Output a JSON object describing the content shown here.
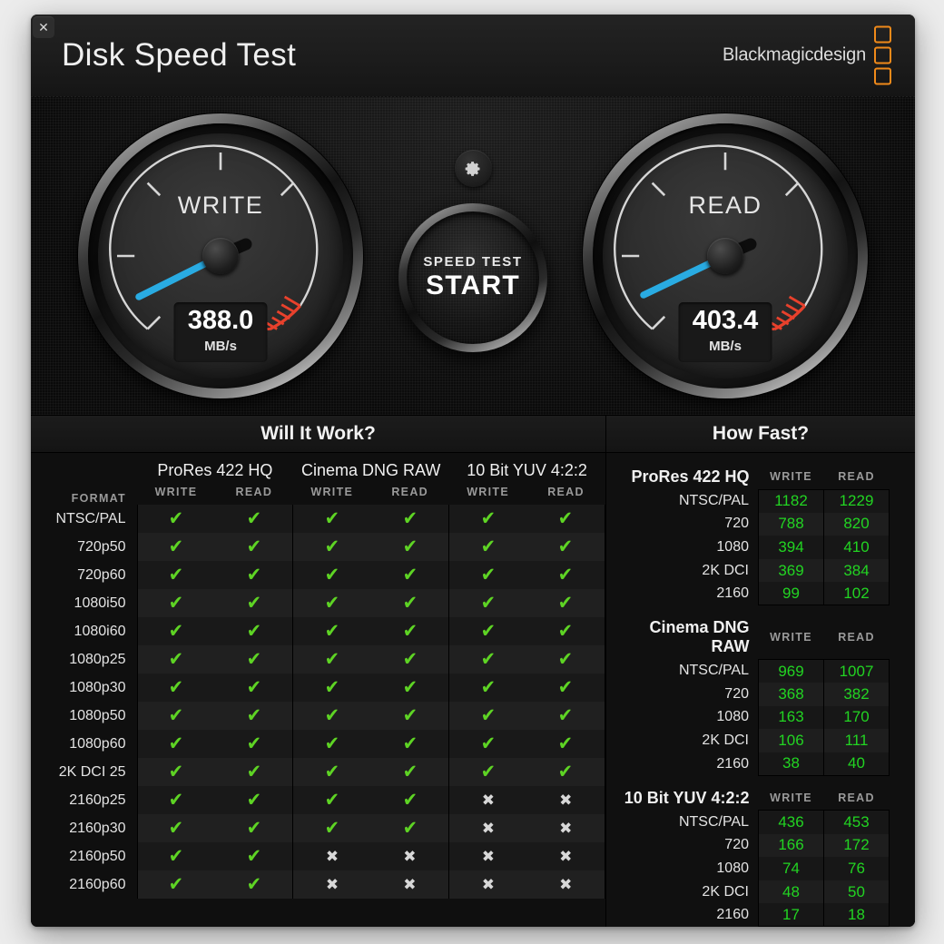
{
  "window": {
    "title": "Disk Speed Test",
    "close_label": "✕",
    "brand": "Blackmagicdesign"
  },
  "gauges": {
    "write": {
      "label": "WRITE",
      "value": "388.0",
      "unit": "MB/s",
      "numeric": 388.0
    },
    "read": {
      "label": "READ",
      "value": "403.4",
      "unit": "MB/s",
      "numeric": 403.4
    }
  },
  "controls": {
    "gear_icon": "gear-icon",
    "start_line1": "SPEED TEST",
    "start_line2": "START"
  },
  "will_it_work": {
    "heading": "Will It Work?",
    "format_header": "FORMAT",
    "codecs": [
      "ProRes 422 HQ",
      "Cinema DNG RAW",
      "10 Bit YUV 4:2:2"
    ],
    "sub_headers": [
      "WRITE",
      "READ"
    ],
    "ok_glyph": "✔",
    "no_glyph": "✖",
    "formats": [
      "NTSC/PAL",
      "720p50",
      "720p60",
      "1080i50",
      "1080i60",
      "1080p25",
      "1080p30",
      "1080p50",
      "1080p60",
      "2K DCI 25",
      "2160p25",
      "2160p30",
      "2160p50",
      "2160p60"
    ],
    "rows": [
      {
        "format": "NTSC/PAL",
        "cells": [
          true,
          true,
          true,
          true,
          true,
          true
        ]
      },
      {
        "format": "720p50",
        "cells": [
          true,
          true,
          true,
          true,
          true,
          true
        ]
      },
      {
        "format": "720p60",
        "cells": [
          true,
          true,
          true,
          true,
          true,
          true
        ]
      },
      {
        "format": "1080i50",
        "cells": [
          true,
          true,
          true,
          true,
          true,
          true
        ]
      },
      {
        "format": "1080i60",
        "cells": [
          true,
          true,
          true,
          true,
          true,
          true
        ]
      },
      {
        "format": "1080p25",
        "cells": [
          true,
          true,
          true,
          true,
          true,
          true
        ]
      },
      {
        "format": "1080p30",
        "cells": [
          true,
          true,
          true,
          true,
          true,
          true
        ]
      },
      {
        "format": "1080p50",
        "cells": [
          true,
          true,
          true,
          true,
          true,
          true
        ]
      },
      {
        "format": "1080p60",
        "cells": [
          true,
          true,
          true,
          true,
          true,
          true
        ]
      },
      {
        "format": "2K DCI 25",
        "cells": [
          true,
          true,
          true,
          true,
          true,
          true
        ]
      },
      {
        "format": "2160p25",
        "cells": [
          true,
          true,
          true,
          true,
          false,
          false
        ]
      },
      {
        "format": "2160p30",
        "cells": [
          true,
          true,
          true,
          true,
          false,
          false
        ]
      },
      {
        "format": "2160p50",
        "cells": [
          true,
          true,
          false,
          false,
          false,
          false
        ]
      },
      {
        "format": "2160p60",
        "cells": [
          true,
          true,
          false,
          false,
          false,
          false
        ]
      }
    ]
  },
  "how_fast": {
    "heading": "How Fast?",
    "col_write": "WRITE",
    "col_read": "READ",
    "groups": [
      {
        "name": "ProRes 422 HQ",
        "rows": [
          {
            "label": "NTSC/PAL",
            "write": "1182",
            "read": "1229"
          },
          {
            "label": "720",
            "write": "788",
            "read": "820"
          },
          {
            "label": "1080",
            "write": "394",
            "read": "410"
          },
          {
            "label": "2K DCI",
            "write": "369",
            "read": "384"
          },
          {
            "label": "2160",
            "write": "99",
            "read": "102"
          }
        ]
      },
      {
        "name": "Cinema DNG RAW",
        "rows": [
          {
            "label": "NTSC/PAL",
            "write": "969",
            "read": "1007"
          },
          {
            "label": "720",
            "write": "368",
            "read": "382"
          },
          {
            "label": "1080",
            "write": "163",
            "read": "170"
          },
          {
            "label": "2K DCI",
            "write": "106",
            "read": "111"
          },
          {
            "label": "2160",
            "write": "38",
            "read": "40"
          }
        ]
      },
      {
        "name": "10 Bit YUV 4:2:2",
        "rows": [
          {
            "label": "NTSC/PAL",
            "write": "436",
            "read": "453"
          },
          {
            "label": "720",
            "write": "166",
            "read": "172"
          },
          {
            "label": "1080",
            "write": "74",
            "read": "76"
          },
          {
            "label": "2K DCI",
            "write": "48",
            "read": "50"
          },
          {
            "label": "2160",
            "write": "17",
            "read": "18"
          }
        ]
      }
    ]
  },
  "colors": {
    "needle": "#29abe2",
    "redzone": "#e8412c",
    "check": "#5ed424",
    "value_green": "#22d422",
    "brand_orange": "#f08a1a",
    "panel_bg": "#0f0f0f"
  }
}
